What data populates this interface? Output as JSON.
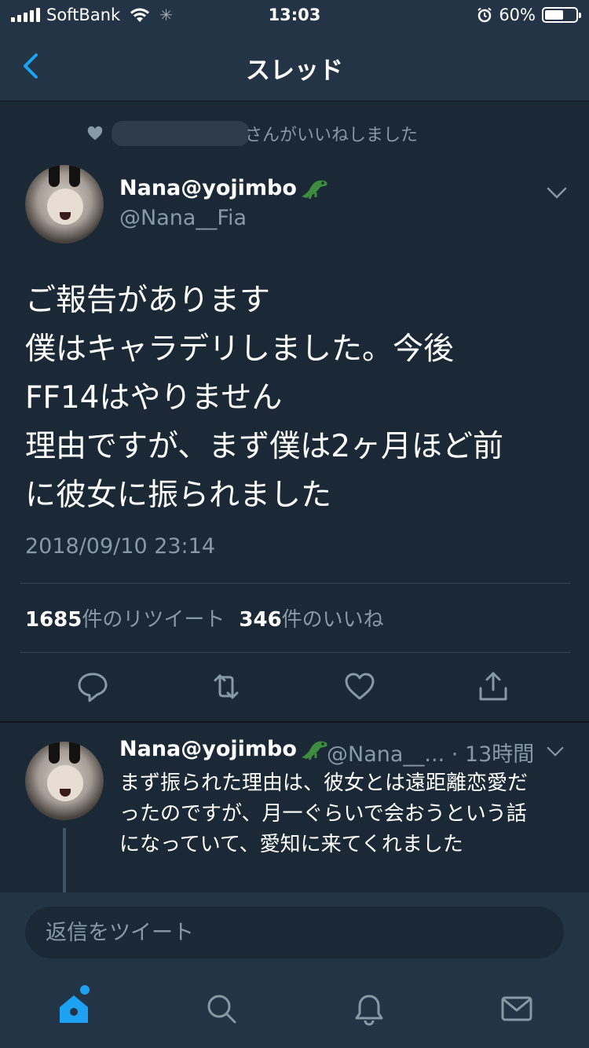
{
  "status_bar": {
    "carrier": "SoftBank",
    "time": "13:03",
    "battery": "60%",
    "battery_level": 0.6
  },
  "nav": {
    "title": "スレッド"
  },
  "social_context": {
    "text": "さんがいいねしました"
  },
  "tweet": {
    "name": "Nana@yojimbo",
    "handle": "@Nana__Fia",
    "lines": [
      "ご報告があります",
      "僕はキャラデリしました。今後",
      "FF14はやりません",
      "理由ですが、まず僕は2ヶ月ほど前",
      "に彼女に振られました"
    ],
    "timestamp": "2018/09/10 23:14",
    "retweet_count": "1685",
    "retweet_label": "件のリツイート",
    "like_count": "346",
    "like_label": "件のいいね"
  },
  "reply": {
    "name": "Nana@yojimbo",
    "handle": "@Nana__...",
    "time": "· 13時間",
    "lines": [
      "まず振られた理由は、彼女とは遠距離恋愛だ",
      "ったのですが、月一ぐらいで会おうという話",
      "になっていて、愛知に来てくれました"
    ]
  },
  "composer": {
    "placeholder": "返信をツイート"
  },
  "colors": {
    "background": "#1b2836",
    "bar": "#243447",
    "accent": "#1da1f2",
    "secondary_text": "#8899a6"
  },
  "icons": {
    "back": "chevron-left-icon",
    "reply": "comment-icon",
    "retweet": "retweet-icon",
    "like": "heart-icon",
    "share": "share-icon",
    "home": "home-icon",
    "search": "search-icon",
    "notifications": "bell-icon",
    "messages": "envelope-icon"
  }
}
